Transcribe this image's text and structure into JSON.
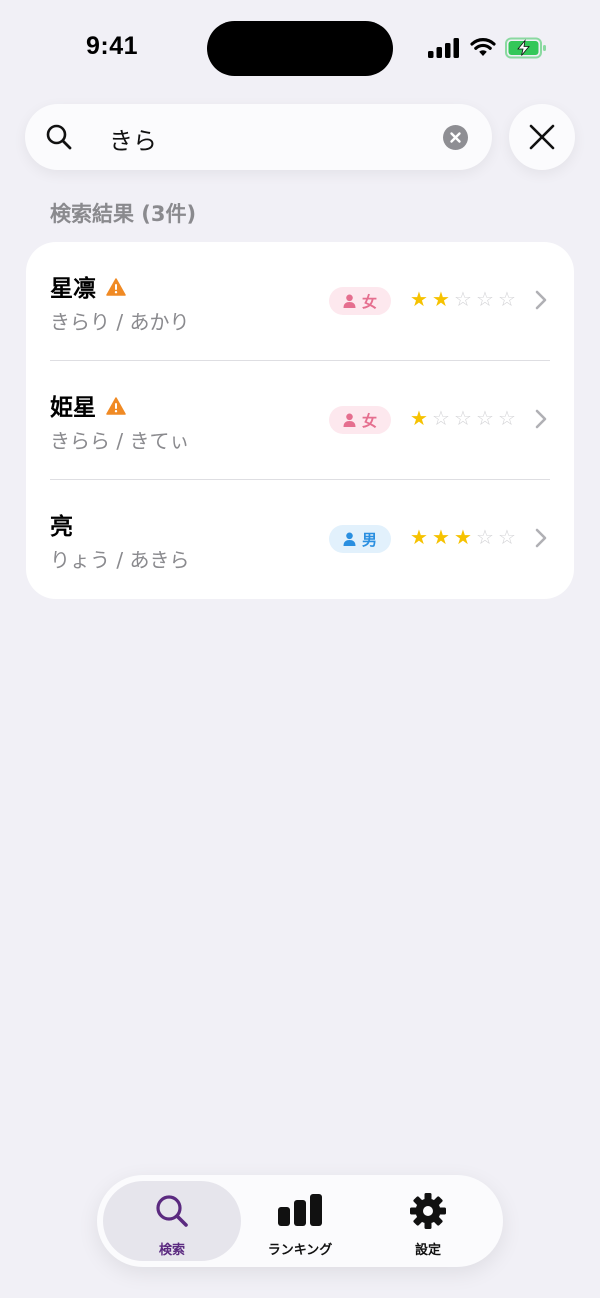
{
  "status_bar": {
    "time": "9:41"
  },
  "search": {
    "query": "きら"
  },
  "results": {
    "label": "検索結果 (3件)",
    "items": [
      {
        "kanji": "星凛",
        "reading": "きらり / あかり",
        "warning": true,
        "gender": "女",
        "gender_type": "female",
        "rating": 2,
        "rating_max": 5
      },
      {
        "kanji": "姫星",
        "reading": "きらら / きてぃ",
        "warning": true,
        "gender": "女",
        "gender_type": "female",
        "rating": 1,
        "rating_max": 5
      },
      {
        "kanji": "亮",
        "reading": "りょう / あきら",
        "warning": false,
        "gender": "男",
        "gender_type": "male",
        "rating": 3,
        "rating_max": 5
      }
    ]
  },
  "tab_bar": {
    "tabs": [
      {
        "label": "検索",
        "icon": "search-icon",
        "active": true
      },
      {
        "label": "ランキング",
        "icon": "bar-chart-icon",
        "active": false
      },
      {
        "label": "設定",
        "icon": "gear-icon",
        "active": false
      }
    ]
  },
  "colors": {
    "accent": "#5b2a80",
    "star": "#f6c200",
    "warning": "#f08a24",
    "female": "#e56f8f",
    "male": "#2a8fe0",
    "battery": "#34c759"
  }
}
